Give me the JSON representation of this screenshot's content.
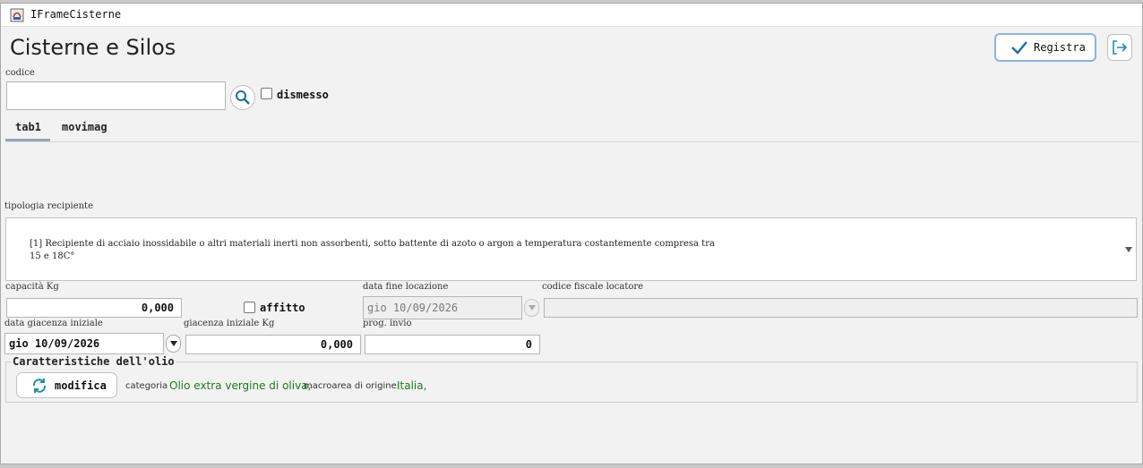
{
  "window": {
    "title": "IFrameCisterne"
  },
  "page": {
    "title": "Cisterne e Silos"
  },
  "toolbar": {
    "registra_label": "Registra",
    "exit_icon": "exit-icon",
    "accent": "#8ab4e6"
  },
  "codice": {
    "label": "codice",
    "value": ""
  },
  "dismesso": {
    "label": "dismesso",
    "checked": false
  },
  "tabs": [
    {
      "label": "tab1",
      "selected": true
    },
    {
      "label": "movimag",
      "selected": false
    }
  ],
  "tipologia": {
    "label": "tipologia recipiente",
    "value": "[1] Recipiente di acciaio inossidabile o altri materiali inerti non assorbenti, sotto battente di azoto o argon a temperatura costantemente compresa tra\n15 e 18C°"
  },
  "capacita": {
    "label": "capacità Kg",
    "value": "0,000"
  },
  "affitto": {
    "label": "affitto",
    "checked": false
  },
  "data_fine_locazione": {
    "label": "data fine locazione",
    "value": "gio 10/09/2026"
  },
  "codice_fiscale_locatore": {
    "label": "codice fiscale locatore",
    "value": ""
  },
  "data_giacenza_iniziale": {
    "label": "data giacenza iniziale",
    "value": "gio 10/09/2026"
  },
  "giacenza_iniziale": {
    "label": "giacenza iniziale Kg",
    "value": "0,000"
  },
  "prog_invio": {
    "label": "prog. invio",
    "value": "0"
  },
  "caratteristiche": {
    "title": "Caratteristiche dell'olio",
    "modifica_label": "modifica",
    "categoria_label": "categoria",
    "categoria_value": "Olio extra vergine di oliva,",
    "macroarea_label": "macroarea di origine",
    "macroarea_value": "Italia,",
    "value_color": "#1f7a1f"
  }
}
